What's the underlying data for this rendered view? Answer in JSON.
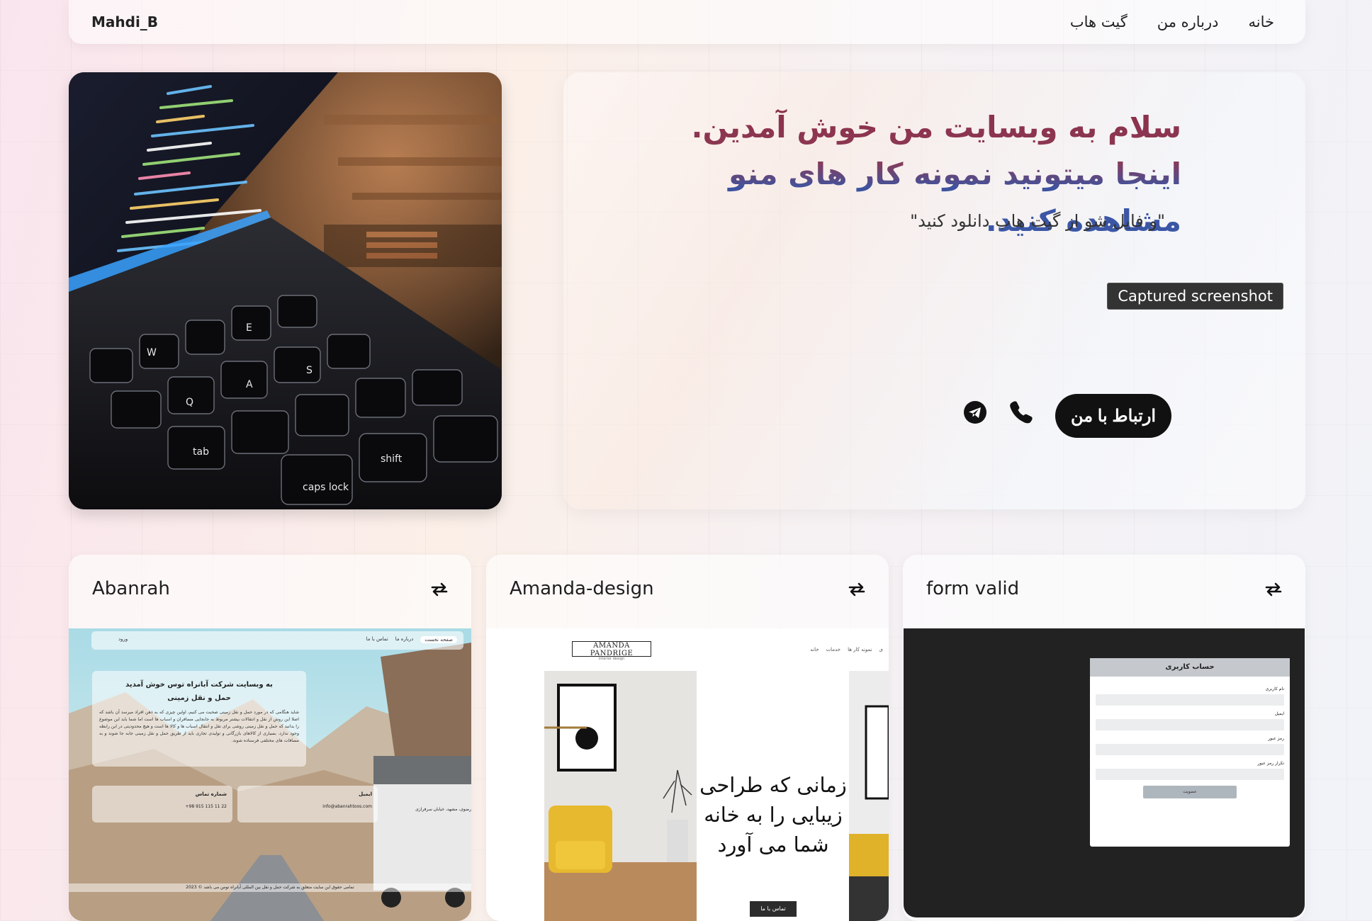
{
  "header": {
    "brand": "Mahdi_B",
    "nav": [
      {
        "label": "خانه"
      },
      {
        "label": "درباره من"
      },
      {
        "label": "گیت هاب"
      }
    ]
  },
  "hero": {
    "title": "سلام به وبسایت من خوش آمدین. اینجا میتونید نمونه کار های منو مشاهده کنید.",
    "subtitle": "\"و فایل شو از گیت هاب دانلود کنید\"",
    "tooltip": "Captured screenshot",
    "contact_button": "ارتباط با من",
    "icons": [
      "phone-icon",
      "telegram-icon"
    ]
  },
  "projects": [
    {
      "title": "Abanrah",
      "shot": {
        "nav": [
          "صفحه نخست",
          "درباره ما",
          "تماس با ما",
          "ورود"
        ],
        "heading": "به وبسایت شرکت آبانراه توس خوش آمدید",
        "subheading": "حمل و نقل زمینی",
        "body": "شاید هنگامی که در مورد حمل و نقل زمینی صحبت می کنیم، اولین چیزی که به ذهن افراد میرسد آن باشد که اصلا این روش از نقل و انتقالات بیشتر مربوط به جابجایی مسافران و اسباب ها است اما شما باید این موضوع را بدانید که حمل و نقل زمینی روشی برای نقل و انتقال اسباب ها و کالا ها است و هیچ محدودیتی در این رابطه وجود ندارد. بسیاری از کالاهای بازرگانی و تولیدی تجاری باید از طریق حمل و نقل زمینی جابه جا شوند و به مسافات های مختلفی فرستاده شوند.",
        "phone_label": "شماره تماس",
        "phone": "+98 915 115 11 22",
        "email_label": "ایمیل",
        "email": "info@abanrahtoos.com",
        "address": "رضوی، مشهد، خیابان سرفرازی",
        "footer": "تمامی حقوق این سایت متعلق به شرکت حمل و نقل بین المللی آبانراه توس می باشد © 2023"
      }
    },
    {
      "title": "Amanda-design",
      "shot": {
        "logo": "AMANDA PANDRIGE",
        "logo_sub": "interior design",
        "nav": [
          "خانه",
          "خدمات",
          "نمونه کار ها",
          "ی"
        ],
        "headline": "زمانی که طراحی زیبایی را به خانه شما می آورد",
        "cta": "تماس با ما"
      }
    },
    {
      "title": "form valid",
      "shot": {
        "form_title": "حساب کاربری",
        "fields": [
          "نام کاربری",
          "ایمیل",
          "رمز عبور",
          "تکرار رمز عبور"
        ],
        "submit": "عضویت"
      }
    }
  ]
}
